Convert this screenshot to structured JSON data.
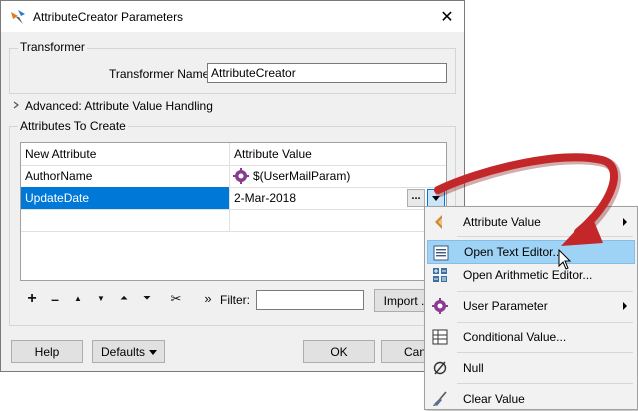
{
  "window": {
    "title": "AttributeCreator Parameters",
    "close_glyph": "✕"
  },
  "transformer": {
    "group_label": "Transformer",
    "name_label": "Transformer Name:",
    "name_value": "AttributeCreator"
  },
  "advanced": {
    "label": "Advanced: Attribute Value Handling"
  },
  "attributes": {
    "group_label": "Attributes To Create",
    "columns": [
      "New Attribute",
      "Attribute Value"
    ],
    "rows": [
      {
        "name": "AuthorName",
        "value": "$(UserMailParam)"
      },
      {
        "name": "UpdateDate",
        "value": "2-Mar-2018"
      }
    ]
  },
  "toolbar": {
    "add_glyph": "+",
    "remove_glyph": "–",
    "up_glyph": "▲",
    "down_glyph": "▼",
    "top_glyph": "⏶",
    "bottom_glyph": "⏷",
    "cut_glyph": "✂",
    "more_glyph": "»",
    "filter_label": "Filter:",
    "filter_value": "",
    "import_label": "Import ."
  },
  "footer": {
    "help_label": "Help",
    "defaults_label": "Defaults",
    "ok_label": "OK",
    "cancel_label": "Canc"
  },
  "cell_buttons": {
    "ellipsis_label": "..."
  },
  "context_menu": {
    "items": [
      {
        "label": "Attribute Value",
        "icon": "attribute-value-icon",
        "submenu": true
      },
      {
        "label": "Open Text Editor...",
        "icon": "text-editor-icon",
        "submenu": false,
        "highlighted": true
      },
      {
        "label": "Open Arithmetic Editor...",
        "icon": "arithmetic-editor-icon",
        "submenu": false
      },
      {
        "label": "User Parameter",
        "icon": "user-parameter-icon",
        "submenu": true
      },
      {
        "label": "Conditional Value...",
        "icon": "conditional-value-icon",
        "submenu": false
      },
      {
        "label": "Null",
        "icon": "null-icon",
        "submenu": false
      },
      {
        "label": "Clear Value",
        "icon": "clear-value-icon",
        "submenu": false
      }
    ]
  },
  "colors": {
    "selection": "#0078d7",
    "menu_highlight": "#9fd3f5",
    "arrow": "#c4272a"
  }
}
